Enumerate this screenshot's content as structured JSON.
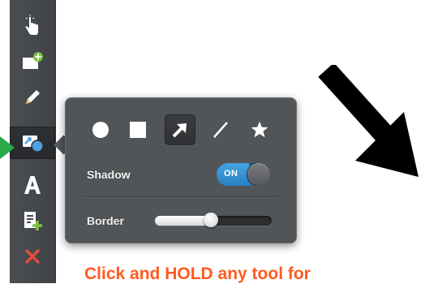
{
  "toolbar": {
    "tools": [
      {
        "name": "pointer-tool",
        "icon": "hand-pointer-icon"
      },
      {
        "name": "add-image-tool",
        "icon": "image-plus-icon"
      },
      {
        "name": "pen-tool",
        "icon": "pencil-icon"
      },
      {
        "name": "shapes-tool",
        "icon": "shapes-icon",
        "selected": true
      },
      {
        "name": "text-tool",
        "icon": "text-a-icon"
      },
      {
        "name": "add-page-tool",
        "icon": "page-plus-icon"
      },
      {
        "name": "delete-tool",
        "icon": "close-x-icon"
      }
    ]
  },
  "popup": {
    "shapes": [
      {
        "name": "circle",
        "icon": "circle-icon"
      },
      {
        "name": "square",
        "icon": "square-icon"
      },
      {
        "name": "arrow",
        "icon": "arrow-icon",
        "selected": true
      },
      {
        "name": "line",
        "icon": "line-icon"
      },
      {
        "name": "star",
        "icon": "star-icon"
      }
    ],
    "shadow_label": "Shadow",
    "shadow_toggle_text": "ON",
    "shadow_on": true,
    "border_label": "Border",
    "border_level_fraction": 0.48
  },
  "caption": "Click and HOLD any tool for",
  "colors": {
    "toolbar_bg": "#45484c",
    "popup_bg": "#525558",
    "toggle_blue": "#2f8ad0",
    "green_pointer": "#2aa84a",
    "caption_orange": "#ff5a1f",
    "accent_blue": "#4aa3e6",
    "add_green": "#7cc242",
    "delete_red": "#e24c3c"
  }
}
